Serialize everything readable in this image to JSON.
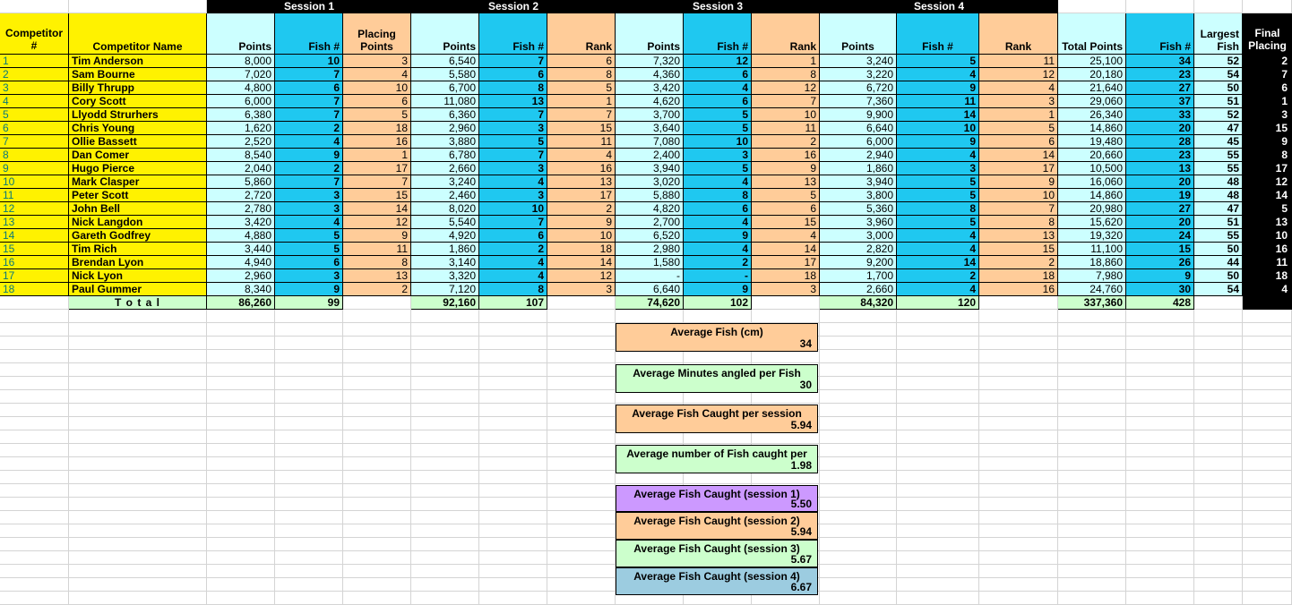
{
  "sessions": [
    "Session 1",
    "Session 2",
    "Session 3",
    "Session 4"
  ],
  "headers": {
    "competitor_no": "Competitor #",
    "competitor_name": "Competitor Name",
    "points": "Points",
    "fish": "Fish #",
    "placing_points": "Placing Points",
    "rank": "Rank",
    "total_points": "Total Points",
    "largest_fish": "Largest Fish",
    "final_placing": "Final Placing"
  },
  "rows": [
    [
      "1",
      "Tim Anderson",
      "8,000",
      "10",
      "3",
      "6,540",
      "7",
      "6",
      "7,320",
      "12",
      "1",
      "3,240",
      "5",
      "11",
      "25,100",
      "34",
      "52",
      "2"
    ],
    [
      "2",
      "Sam Bourne",
      "7,020",
      "7",
      "4",
      "5,580",
      "6",
      "8",
      "4,360",
      "6",
      "8",
      "3,220",
      "4",
      "12",
      "20,180",
      "23",
      "54",
      "7"
    ],
    [
      "3",
      "Billy Thrupp",
      "4,800",
      "6",
      "10",
      "6,700",
      "8",
      "5",
      "3,420",
      "4",
      "12",
      "6,720",
      "9",
      "4",
      "21,640",
      "27",
      "50",
      "6"
    ],
    [
      "4",
      "Cory Scott",
      "6,000",
      "7",
      "6",
      "11,080",
      "13",
      "1",
      "4,620",
      "6",
      "7",
      "7,360",
      "11",
      "3",
      "29,060",
      "37",
      "51",
      "1"
    ],
    [
      "5",
      "Llyodd Strurhers",
      "6,380",
      "7",
      "5",
      "6,360",
      "7",
      "7",
      "3,700",
      "5",
      "10",
      "9,900",
      "14",
      "1",
      "26,340",
      "33",
      "52",
      "3"
    ],
    [
      "6",
      "Chris Young",
      "1,620",
      "2",
      "18",
      "2,960",
      "3",
      "15",
      "3,640",
      "5",
      "11",
      "6,640",
      "10",
      "5",
      "14,860",
      "20",
      "47",
      "15"
    ],
    [
      "7",
      "Ollie Bassett",
      "2,520",
      "4",
      "16",
      "3,880",
      "5",
      "11",
      "7,080",
      "10",
      "2",
      "6,000",
      "9",
      "6",
      "19,480",
      "28",
      "45",
      "9"
    ],
    [
      "8",
      "Dan Comer",
      "8,540",
      "9",
      "1",
      "6,780",
      "7",
      "4",
      "2,400",
      "3",
      "16",
      "2,940",
      "4",
      "14",
      "20,660",
      "23",
      "55",
      "8"
    ],
    [
      "9",
      "Hugo Pierce",
      "2,040",
      "2",
      "17",
      "2,660",
      "3",
      "16",
      "3,940",
      "5",
      "9",
      "1,860",
      "3",
      "17",
      "10,500",
      "13",
      "55",
      "17"
    ],
    [
      "10",
      "Mark Clasper",
      "5,860",
      "7",
      "7",
      "3,240",
      "4",
      "13",
      "3,020",
      "4",
      "13",
      "3,940",
      "5",
      "9",
      "16,060",
      "20",
      "48",
      "12"
    ],
    [
      "11",
      "Peter Scott",
      "2,720",
      "3",
      "15",
      "2,460",
      "3",
      "17",
      "5,880",
      "8",
      "5",
      "3,800",
      "5",
      "10",
      "14,860",
      "19",
      "48",
      "14"
    ],
    [
      "12",
      "John Bell",
      "2,780",
      "3",
      "14",
      "8,020",
      "10",
      "2",
      "4,820",
      "6",
      "6",
      "5,360",
      "8",
      "7",
      "20,980",
      "27",
      "47",
      "5"
    ],
    [
      "13",
      "Nick Langdon",
      "3,420",
      "4",
      "12",
      "5,540",
      "7",
      "9",
      "2,700",
      "4",
      "15",
      "3,960",
      "5",
      "8",
      "15,620",
      "20",
      "51",
      "13"
    ],
    [
      "14",
      "Gareth Godfrey",
      "4,880",
      "5",
      "9",
      "4,920",
      "6",
      "10",
      "6,520",
      "9",
      "4",
      "3,000",
      "4",
      "13",
      "19,320",
      "24",
      "55",
      "10"
    ],
    [
      "15",
      "Tim Rich",
      "3,440",
      "5",
      "11",
      "1,860",
      "2",
      "18",
      "2,980",
      "4",
      "14",
      "2,820",
      "4",
      "15",
      "11,100",
      "15",
      "50",
      "16"
    ],
    [
      "16",
      "Brendan Lyon",
      "4,940",
      "6",
      "8",
      "3,140",
      "4",
      "14",
      "1,580",
      "2",
      "17",
      "9,200",
      "14",
      "2",
      "18,860",
      "26",
      "44",
      "11"
    ],
    [
      "17",
      "Nick Lyon",
      "2,960",
      "3",
      "13",
      "3,320",
      "4",
      "12",
      "-",
      "-",
      "18",
      "1,700",
      "2",
      "18",
      "7,980",
      "9",
      "50",
      "18"
    ],
    [
      "18",
      "Paul Gummer",
      "8,340",
      "9",
      "2",
      "7,120",
      "8",
      "3",
      "6,640",
      "9",
      "3",
      "2,660",
      "4",
      "16",
      "24,760",
      "30",
      "54",
      "4"
    ]
  ],
  "totals": {
    "label": "T o t a l",
    "s1_points": "86,260",
    "s1_fish": "99",
    "s2_points": "92,160",
    "s2_fish": "107",
    "s3_points": "74,620",
    "s3_fish": "102",
    "s4_points": "84,320",
    "s4_fish": "120",
    "total_points": "337,360",
    "total_fish": "428"
  },
  "summary": [
    {
      "label": "Average Fish (cm)",
      "value": "34",
      "color": "#ffcc99"
    },
    {
      "label": "Average Minutes  angled per Fish",
      "value": "30",
      "color": "#ccffcc"
    },
    {
      "label": "Average Fish Caught per session",
      "value": "5.94",
      "color": "#ffcc99"
    },
    {
      "label": "Average number of Fish caught per",
      "value": "1.98",
      "color": "#ccffcc"
    },
    {
      "label": "Average Fish Caught  (session 1)",
      "value": "5.50",
      "color": "#cc99ff"
    },
    {
      "label": "Average Fish Caught (session 2)",
      "value": "5.94",
      "color": "#ffcc99"
    },
    {
      "label": "Average Fish Caught (session 3)",
      "value": "5.67",
      "color": "#ccffcc"
    },
    {
      "label": "Average Fish Caught (session 4)",
      "value": "6.67",
      "color": "#9ccce0"
    }
  ],
  "colors": {
    "yellow": "#fff200",
    "light_cyan": "#ccffff",
    "cyan": "#1fc8f0",
    "peach": "#ffcc99",
    "green": "#ccffcc",
    "black": "#000000"
  }
}
